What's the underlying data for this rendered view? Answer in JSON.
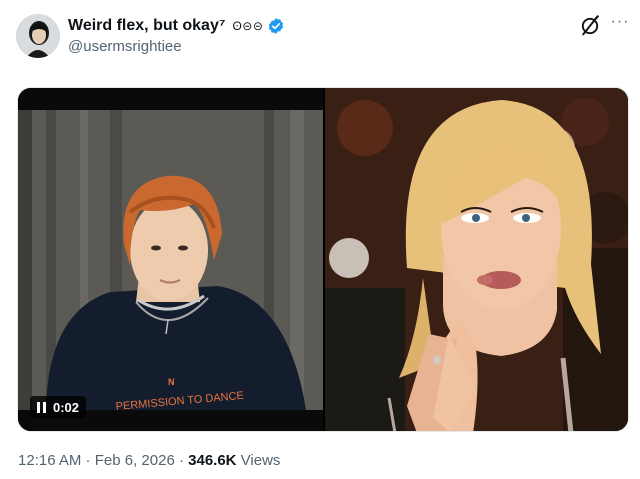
{
  "post": {
    "author_name": "Weird flex, but okay⁷",
    "author_glyphs": "ʘ⊝⊝",
    "handle": "@usermsrightiee",
    "time": "12:16 AM",
    "sep1": " · ",
    "date": "Feb 6, 2026",
    "sep2": " · ",
    "views_count": "346.6K",
    "views_label": " Views"
  },
  "media": {
    "video_time": "0:02",
    "shirt_text": "PERMISSION TO DANCE",
    "shirt_logo": "N"
  },
  "icons": {
    "verified": "verified-badge-icon",
    "grok": "grok-icon",
    "more": "more-icon",
    "pause": "pause-icon"
  },
  "colors": {
    "verified_blue": "#1d9bf0",
    "secondary_text": "#536471",
    "primary_text": "#0f1419",
    "shirt_text_orange": "#e8743a"
  }
}
